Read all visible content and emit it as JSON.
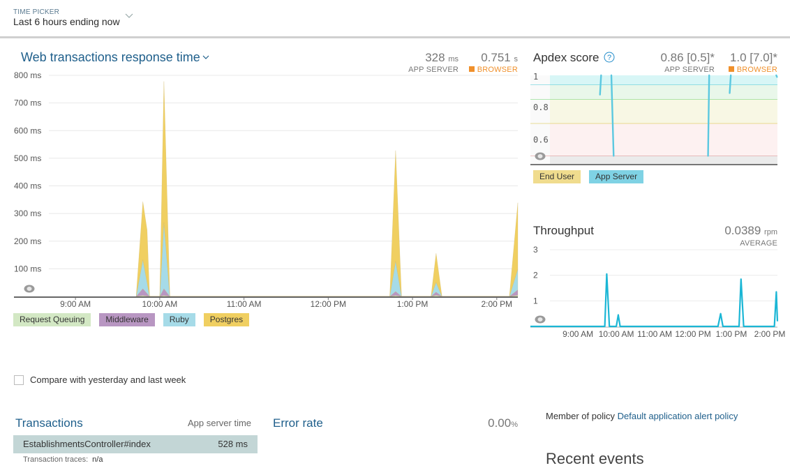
{
  "header": {
    "time_picker_label": "TIME PICKER",
    "time_picker_value": "Last 6 hours ending now"
  },
  "response_time": {
    "title": "Web transactions response time",
    "app_server_value": "328",
    "app_server_unit": "ms",
    "app_server_label": "APP SERVER",
    "browser_value": "0.751",
    "browser_unit": "s",
    "browser_label": "BROWSER",
    "colors": {
      "browser": "#f0902b"
    }
  },
  "apdex": {
    "title": "Apdex score",
    "help_icon": "question-circle-icon",
    "app_server_value": "0.86 [0.5]*",
    "app_server_label": "APP SERVER",
    "browser_value": "1.0 [7.0]*",
    "browser_label": "BROWSER"
  },
  "throughput": {
    "title": "Throughput",
    "value": "0.0389",
    "unit": "rpm",
    "label": "AVERAGE"
  },
  "compare": {
    "label": "Compare with yesterday and last week",
    "checked": false
  },
  "transactions": {
    "title": "Transactions",
    "column": "App server time",
    "rows": [
      {
        "name": "EstablishmentsController#index",
        "value": "528 ms"
      }
    ],
    "traces_label": "Transaction traces:",
    "traces_value": "n/a"
  },
  "error_rate": {
    "title": "Error rate",
    "value": "0.00",
    "unit": "%"
  },
  "policy": {
    "prefix": "Member of policy",
    "link": "Default application alert policy"
  },
  "recent_events": {
    "title": "Recent events"
  },
  "chart_data": [
    {
      "id": "response_time",
      "type": "area",
      "stacked": true,
      "title": "Web transactions response time",
      "ylabel": "",
      "yunit": "ms",
      "ylim": [
        0,
        800
      ],
      "yticks": [
        100,
        200,
        300,
        400,
        500,
        600,
        700,
        800
      ],
      "ytick_labels": [
        "100 ms",
        "200 ms",
        "300 ms",
        "400 ms",
        "500 ms",
        "600 ms",
        "700 ms",
        "800 ms"
      ],
      "xlim_hours": [
        8.27,
        14.25
      ],
      "xticks_hours": [
        9,
        10,
        11,
        12,
        13,
        14
      ],
      "xtick_labels": [
        "9:00 AM",
        "10:00 AM",
        "11:00 AM",
        "12:00 PM",
        "1:00 PM",
        "2:00 PM"
      ],
      "grid": true,
      "legend": "bottom",
      "series": [
        {
          "name": "Request Queuing",
          "color": "#d3e8c4",
          "points": [
            [
              9.72,
              0
            ],
            [
              9.8,
              3
            ],
            [
              9.88,
              0
            ],
            [
              10.0,
              0
            ],
            [
              10.05,
              3
            ],
            [
              10.12,
              0
            ],
            [
              12.73,
              0
            ],
            [
              12.8,
              3
            ],
            [
              12.87,
              0
            ],
            [
              13.22,
              0
            ],
            [
              13.28,
              4
            ],
            [
              13.35,
              0
            ],
            [
              14.15,
              0
            ],
            [
              14.25,
              4
            ]
          ]
        },
        {
          "name": "Middleware",
          "color": "#b896c2",
          "points": [
            [
              9.72,
              0
            ],
            [
              9.8,
              25
            ],
            [
              9.88,
              0
            ],
            [
              10.0,
              0
            ],
            [
              10.05,
              25
            ],
            [
              10.12,
              0
            ],
            [
              12.73,
              0
            ],
            [
              12.8,
              15
            ],
            [
              12.87,
              0
            ],
            [
              13.22,
              0
            ],
            [
              13.28,
              12
            ],
            [
              13.35,
              0
            ],
            [
              14.15,
              0
            ],
            [
              14.25,
              20
            ]
          ]
        },
        {
          "name": "Ruby",
          "color": "#a6dbe8",
          "points": [
            [
              9.72,
              0
            ],
            [
              9.8,
              105
            ],
            [
              9.88,
              0
            ],
            [
              10.0,
              0
            ],
            [
              10.05,
              240
            ],
            [
              10.12,
              0
            ],
            [
              12.73,
              0
            ],
            [
              12.8,
              110
            ],
            [
              12.87,
              0
            ],
            [
              13.22,
              0
            ],
            [
              13.28,
              35
            ],
            [
              13.35,
              0
            ],
            [
              14.15,
              0
            ],
            [
              14.25,
              75
            ]
          ]
        },
        {
          "name": "Postgres",
          "color": "#f0cf61",
          "points": [
            [
              9.72,
              0
            ],
            [
              9.8,
              210
            ],
            [
              9.85,
              190
            ],
            [
              9.88,
              0
            ],
            [
              10.0,
              0
            ],
            [
              10.05,
              510
            ],
            [
              10.12,
              0
            ],
            [
              12.73,
              0
            ],
            [
              12.8,
              400
            ],
            [
              12.87,
              0
            ],
            [
              13.22,
              0
            ],
            [
              13.28,
              105
            ],
            [
              13.35,
              0
            ],
            [
              14.15,
              0
            ],
            [
              14.25,
              240
            ]
          ]
        }
      ]
    },
    {
      "id": "apdex",
      "type": "line",
      "title": "Apdex score",
      "ylim": [
        0.45,
        1
      ],
      "yticks": [
        0.6,
        0.8,
        1
      ],
      "ytick_labels": [
        "0.6",
        "0.8",
        "1"
      ],
      "bands": [
        {
          "from": 0.94,
          "to": 1.0,
          "color": "#d8f6f6",
          "line": "#3cc3cf"
        },
        {
          "from": 0.85,
          "to": 0.94,
          "color": "#e9f7ea",
          "line": "#6ad36a"
        },
        {
          "from": 0.7,
          "to": 0.85,
          "color": "#f8f7e4",
          "line": "#d6bf3a"
        },
        {
          "from": 0.5,
          "to": 0.7,
          "color": "#fdf1f1",
          "line": "#e08080"
        },
        {
          "from": 0.45,
          "to": 0.5,
          "color": "#ebebeb",
          "line": null
        }
      ],
      "legend": "bottom",
      "legend_entries": [
        {
          "name": "End User",
          "color": "#f0dc8e"
        },
        {
          "name": "App Server",
          "color": "#7fd2e4"
        }
      ],
      "series": [
        {
          "name": "App Server",
          "color": "#5bc8e0",
          "segments": [
            [
              [
                0.225,
                1.0
              ],
              [
                0.22,
                0.88
              ]
            ],
            [
              [
                0.27,
                1.0
              ],
              [
                0.28,
                0.5
              ]
            ],
            [
              [
                0.7,
                1.0
              ],
              [
                0.695,
                0.5
              ]
            ],
            [
              [
                0.795,
                1.0
              ],
              [
                0.79,
                0.89
              ]
            ],
            [
              [
                0.995,
                1.0
              ],
              [
                0.998,
                0.99
              ]
            ]
          ]
        }
      ],
      "x_note": "segment x values are fractions of the plotted time window"
    },
    {
      "id": "throughput",
      "type": "line",
      "title": "Throughput",
      "yunit": "rpm",
      "ylim": [
        0,
        3
      ],
      "yticks": [
        1,
        2,
        3
      ],
      "ytick_labels": [
        "1",
        "2",
        "3"
      ],
      "xlim_hours": [
        8.27,
        14.2
      ],
      "xticks_hours": [
        9,
        10,
        11,
        12,
        13,
        14
      ],
      "xtick_labels": [
        "9:00 AM",
        "10:00 AM",
        "11:00 AM",
        "12:00 PM",
        "1:00 PM",
        "2:00 PM"
      ],
      "grid": true,
      "series": [
        {
          "name": "Throughput",
          "color": "#1bb6d5",
          "points": [
            [
              8.27,
              0
            ],
            [
              9.7,
              0
            ],
            [
              9.75,
              2.05
            ],
            [
              9.82,
              0
            ],
            [
              10.0,
              0
            ],
            [
              10.05,
              0.45
            ],
            [
              10.1,
              0
            ],
            [
              12.65,
              0
            ],
            [
              12.72,
              0.5
            ],
            [
              12.78,
              0
            ],
            [
              13.2,
              0
            ],
            [
              13.25,
              1.85
            ],
            [
              13.32,
              0
            ],
            [
              14.12,
              0
            ],
            [
              14.17,
              1.35
            ],
            [
              14.2,
              0.2
            ]
          ]
        }
      ]
    }
  ]
}
